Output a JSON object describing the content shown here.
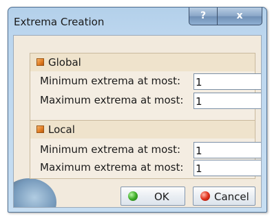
{
  "window": {
    "title": "Extrema Creation",
    "help_label": "?",
    "close_label": "x"
  },
  "global": {
    "title": "Global",
    "min_label": "Minimum extrema at most:",
    "min_value": "1",
    "max_label": "Maximum extrema at most:",
    "max_value": "1"
  },
  "local": {
    "title": "Local",
    "min_label": "Minimum extrema at most:",
    "min_value": "1",
    "max_label": "Maximum extrema at most:",
    "max_value": "1"
  },
  "buttons": {
    "ok_label": "OK",
    "cancel_label": "Cancel"
  },
  "colors": {
    "title_bar": "#b3d0ea",
    "client_bg": "#f2eadd",
    "group_header": "#efe3cc",
    "ok_icon": "#3fae28",
    "cancel_icon": "#e0321e"
  }
}
